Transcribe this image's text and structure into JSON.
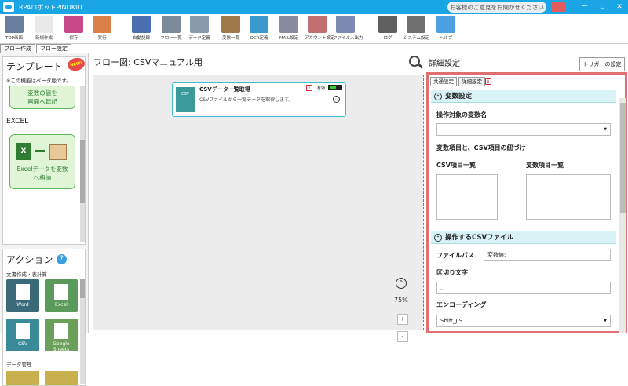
{
  "titlebar": {
    "title": "RPAロボットPINOKIO",
    "feedback": "お客様のご意見をお聞かせください",
    "min": "－",
    "max": "▫",
    "close": "✕"
  },
  "toolbar": {
    "items": [
      {
        "label": "TOP画面",
        "color": "#6a7fa0"
      },
      {
        "label": "新規作成",
        "color": "#e8e8e8"
      },
      {
        "label": "保存",
        "color": "#c94a8a"
      },
      {
        "label": "実行",
        "color": "#d9804a"
      },
      {
        "label": "自動記録",
        "color": "#4a6fb0"
      },
      {
        "label": "フロー一覧",
        "color": "#7a8a9a"
      },
      {
        "label": "データ定義",
        "color": "#8a9aaa"
      },
      {
        "label": "変数一覧",
        "color": "#a0784a"
      },
      {
        "label": "OCR定義",
        "color": "#3a9ad0"
      },
      {
        "label": "MAIL設定",
        "color": "#8a8aa0"
      },
      {
        "label": "アカウント設定",
        "color": "#c07070"
      },
      {
        "label": "ファイル入出力",
        "color": "#7a8ab0"
      },
      {
        "label": "ログ",
        "color": "#606060"
      },
      {
        "label": "システム設定",
        "color": "#707070"
      },
      {
        "label": "ヘルプ",
        "color": "#4aa0e0"
      }
    ]
  },
  "tabs": {
    "flow_create": "フロー作成",
    "flow_settings": "フロー設定"
  },
  "templates": {
    "heading": "テンプレート",
    "badge": "NEW!",
    "beta_note": "※この機能はベータ版です。",
    "card1_line1": "変数の値を",
    "card1_line2": "画面へ転記",
    "section": "EXCEL",
    "card2_line1": "Excelデータを変数",
    "card2_line2": "へ格納"
  },
  "actions": {
    "heading": "アクション",
    "help": "?",
    "section1": "文書作成・表計算",
    "section2": "データ管理",
    "tiles": [
      {
        "label": "Word",
        "glyph": "W",
        "color": "#3a6a7a"
      },
      {
        "label": "Excel",
        "glyph": "X",
        "color": "#5a9a5a"
      },
      {
        "label": "CSV",
        "glyph": "CSV",
        "color": "#3a8a9a"
      },
      {
        "label": "Google Sheets",
        "glyph": "G",
        "color": "#6aa05a"
      }
    ]
  },
  "flow": {
    "heading": "フロー図:  CSVマニュアル用",
    "node_title": "CSVデータ一覧取得",
    "node_desc": "CSVファイルから一覧データを取得します。",
    "node_icon": "CSV",
    "enabled_label": "有効",
    "warn": "!",
    "zoom": "75%",
    "zoom_in": "+",
    "zoom_out": "-"
  },
  "detail": {
    "heading": "詳細設定",
    "trigger": "トリガーの設定",
    "tab_common": "共通設定",
    "tab_detail": "詳細設定",
    "var_section": "変数設定",
    "target_var": "操作対象の変数名",
    "mapping": "変数項目と、CSV項目の紐づけ",
    "csv_list": "CSV項目一覧",
    "var_list": "変数項目一覧",
    "file_section": "操作するCSVファイル",
    "file_path": "ファイルパス",
    "file_path_value": "変数値:",
    "delimiter": "区切り文字",
    "delimiter_value": ",",
    "encoding": "エンコーディング",
    "encoding_value": "Shift_JIS"
  }
}
